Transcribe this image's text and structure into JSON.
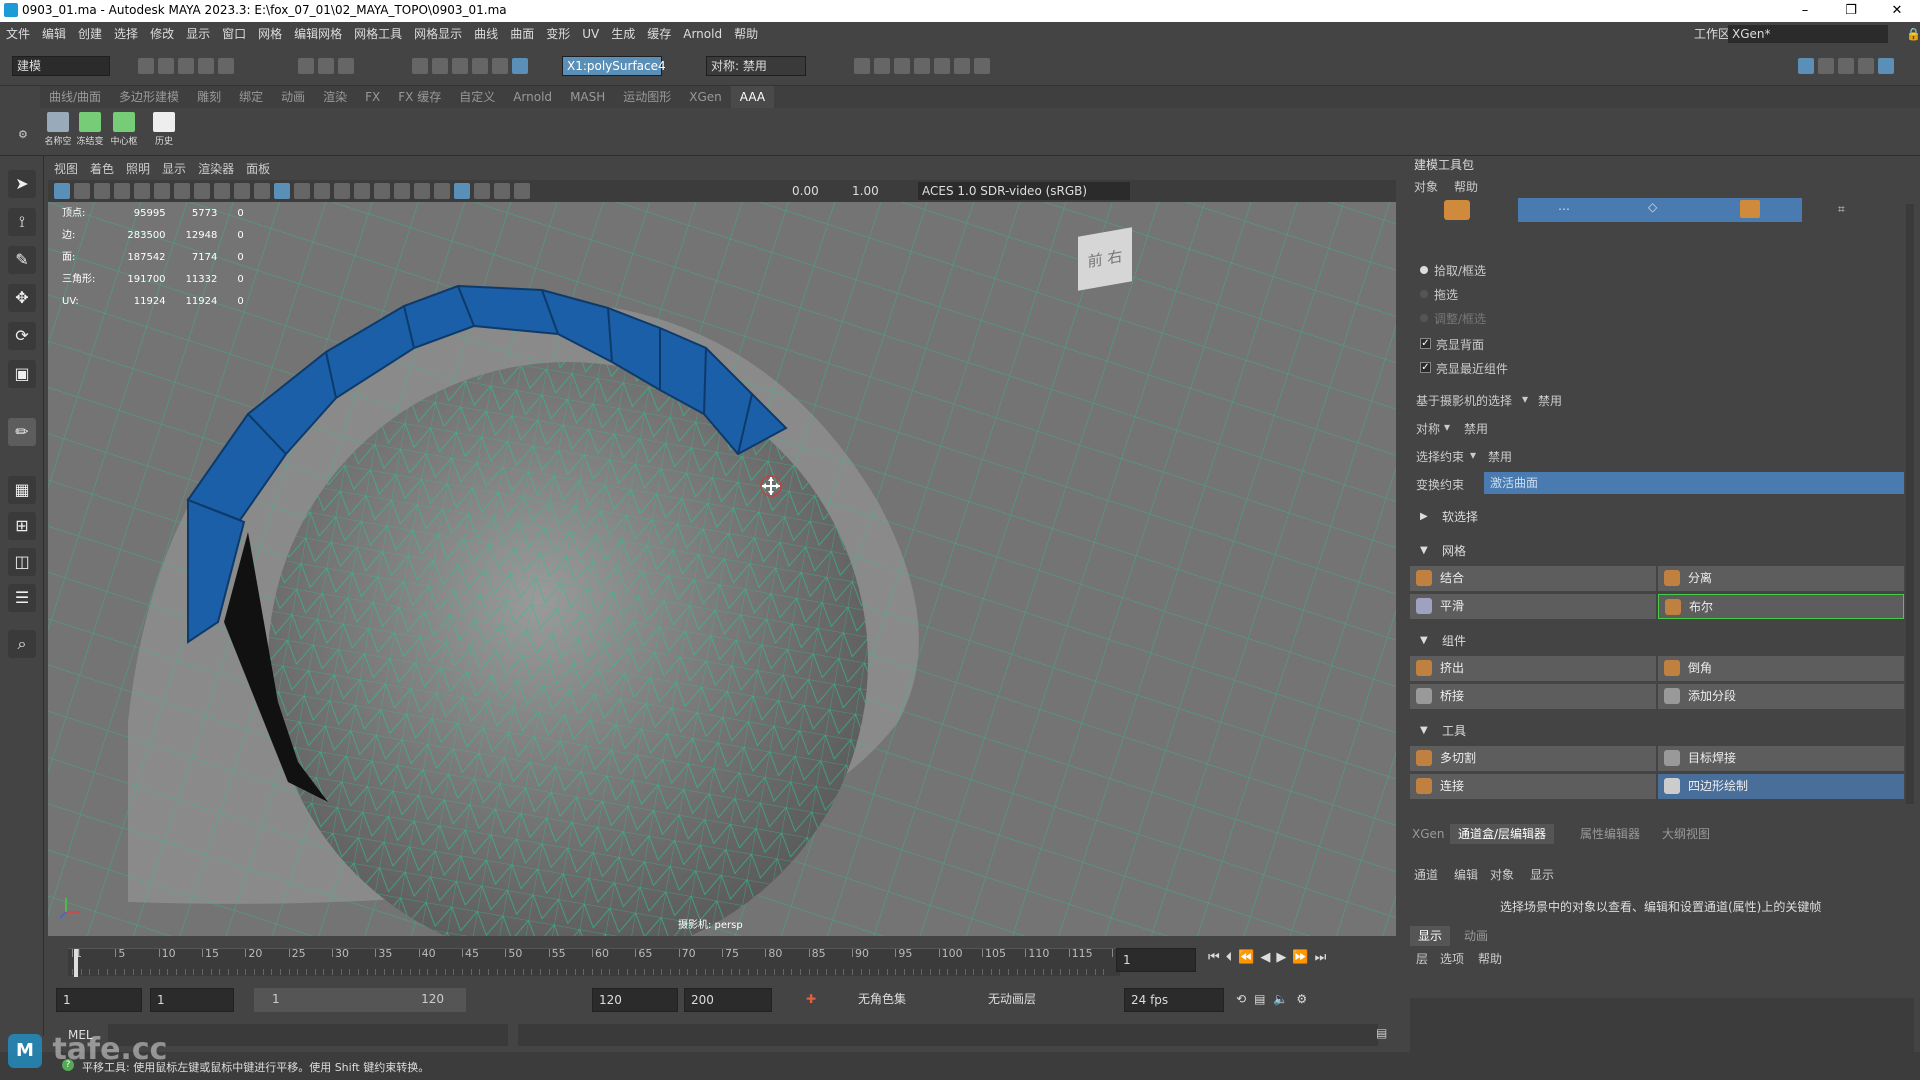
{
  "title": "0903_01.ma - Autodesk MAYA 2023.3: E:\\fox_07_01\\02_MAYA_TOPO\\0903_01.ma",
  "window_controls": {
    "min": "–",
    "max": "❐",
    "close": "✕"
  },
  "menu": [
    "文件",
    "编辑",
    "创建",
    "选择",
    "修改",
    "显示",
    "窗口",
    "网格",
    "编辑网格",
    "网格工具",
    "网格显示",
    "曲线",
    "曲面",
    "变形",
    "UV",
    "生成",
    "缓存",
    "Arnold",
    "帮助"
  ],
  "workspace": {
    "label": "工作区:",
    "value": "XGen*"
  },
  "status": {
    "mode": "建模",
    "object_field": "X1:polySurface4",
    "symmetry": "对称: 禁用"
  },
  "shelf_tabs": [
    "曲线/曲面",
    "多边形建模",
    "雕刻",
    "绑定",
    "动画",
    "渲染",
    "FX",
    "FX 缓存",
    "自定义",
    "Arnold",
    "MASH",
    "运动图形",
    "XGen",
    "AAA"
  ],
  "shelf_active": "AAA",
  "shelf_buttons": [
    "名称空",
    "冻结变",
    "中心枢",
    "历史"
  ],
  "viewport_menu": [
    "视图",
    "着色",
    "照明",
    "显示",
    "渲染器",
    "面板"
  ],
  "viewport_toolbar": {
    "exposure": "0.00",
    "gamma": "1.00",
    "colorspace": "ACES 1.0 SDR-video (sRGB)"
  },
  "hud": {
    "rows": [
      {
        "label": "顶点:",
        "a": "95995",
        "b": "5773",
        "c": "0"
      },
      {
        "label": "边:",
        "a": "283500",
        "b": "12948",
        "c": "0"
      },
      {
        "label": "面:",
        "a": "187542",
        "b": "7174",
        "c": "0"
      },
      {
        "label": "三角形:",
        "a": "191700",
        "b": "11332",
        "c": "0"
      },
      {
        "label": "UV:",
        "a": "11924",
        "b": "11924",
        "c": "0"
      }
    ],
    "camera": "摄影机: persp",
    "viewcube": "前 右"
  },
  "right_panel": {
    "title": "建模工具包",
    "menu": [
      "对象",
      "帮助"
    ],
    "select_modes": [
      "拾取/框选",
      "拖选",
      "调整/框选"
    ],
    "checks": [
      {
        "label": "亮显背面",
        "checked": true
      },
      {
        "label": "亮显最近组件",
        "checked": true
      }
    ],
    "camera_select": {
      "label": "基于摄影机的选择",
      "value": "禁用"
    },
    "symmetry": {
      "label": "对称",
      "value": "禁用"
    },
    "select_constraint": {
      "label": "选择约束",
      "value": "禁用"
    },
    "transform_constraint": {
      "label": "变换约束",
      "value": "激活曲面"
    },
    "soft_select": "软选择",
    "sections": [
      {
        "title": "网格",
        "buttons": [
          [
            "结合",
            "分离"
          ],
          [
            "平滑",
            "布尔"
          ]
        ]
      },
      {
        "title": "组件",
        "buttons": [
          [
            "挤出",
            "倒角"
          ],
          [
            "桥接",
            "添加分段"
          ]
        ]
      },
      {
        "title": "工具",
        "buttons": [
          [
            "多切割",
            "目标焊接"
          ],
          [
            "连接",
            "四边形绘制"
          ]
        ]
      }
    ]
  },
  "channel_box": {
    "tabs": [
      "XGen",
      "通道盒/层编辑器",
      "属性编辑器",
      "大纲视图"
    ],
    "active_tab": "通道盒/层编辑器",
    "menu": [
      "通道",
      "编辑",
      "对象",
      "显示"
    ],
    "message": "选择场景中的对象以查看、编辑和设置通道(属性)上的关键帧",
    "layer_tabs": [
      "显示",
      "动画"
    ],
    "layer_menu": [
      "层",
      "选项",
      "帮助"
    ]
  },
  "timeline": {
    "ticks": [
      "1",
      "5",
      "10",
      "15",
      "20",
      "25",
      "30",
      "35",
      "40",
      "45",
      "50",
      "55",
      "60",
      "65",
      "70",
      "75",
      "80",
      "85",
      "90",
      "95",
      "100",
      "105",
      "110",
      "115",
      "12"
    ],
    "current_frame": "1"
  },
  "range": {
    "start": "1",
    "start2": "1",
    "slider_start": "1",
    "slider_end": "120",
    "end": "120",
    "end2": "200",
    "char_set": "无角色集",
    "anim_layer": "无动画层",
    "fps": "24 fps"
  },
  "command": {
    "lang": "MEL"
  },
  "help_line": "平移工具: 使用鼠标左键或鼠标中键进行平移。使用 Shift 键约束转换。",
  "watermark": "tafe.cc",
  "colors": {
    "accent": "#1d6fb8",
    "selected_face": "#1a5fa8",
    "wire": "#2fbf8f",
    "viewport_bg": "#6b6b6b"
  }
}
